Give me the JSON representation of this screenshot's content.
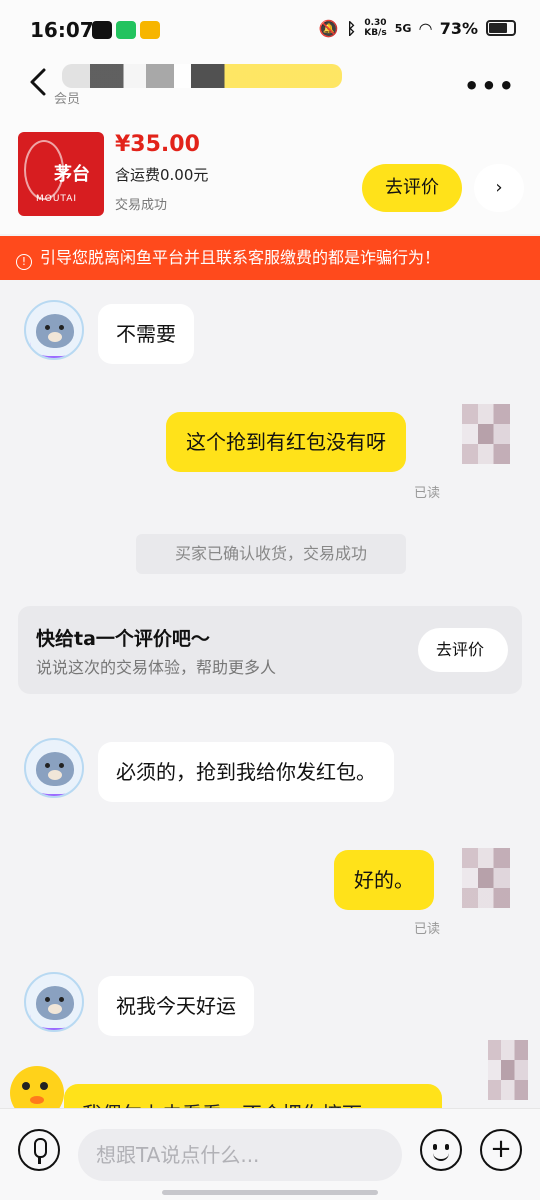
{
  "status_bar": {
    "time": "16:07",
    "net_speed": "0.30",
    "net_unit": "KB/s",
    "signal": "5G",
    "battery": "73%"
  },
  "header": {
    "subtitle": "会员",
    "more_label": "•••"
  },
  "product": {
    "brand_cn": "茅台",
    "brand_en": "MOUTAI",
    "price": "¥35.00",
    "shipping": "含运费0.00元",
    "status": "交易成功",
    "review_button": "去评价"
  },
  "warning": {
    "icon": "!",
    "text": "引导您脱离闲鱼平台并且联系客服缴费的都是诈骗行为！"
  },
  "messages": [
    {
      "side": "left",
      "text": "不需要"
    },
    {
      "side": "right",
      "text": "这个抢到有红包没有呀",
      "read": "已读"
    },
    {
      "side": "left",
      "text": "必须的，抢到我给你发红包。"
    },
    {
      "side": "right",
      "text": "好的。",
      "read": "已读"
    },
    {
      "side": "left",
      "text": "祝我今天好运"
    },
    {
      "side": "right",
      "text": "我偶尔上去看看，不会把你挤下"
    }
  ],
  "system_tip": "买家已确认收货，交易成功",
  "rate_card": {
    "title": "快给ta一个评价吧～",
    "subtitle": "说说这次的交易体验，帮助更多人",
    "button": "去评价"
  },
  "input_bar": {
    "placeholder": "想跟TA说点什么..."
  },
  "colors": {
    "accent_yellow": "#ffe21a",
    "warning_bg": "#ff4a1c",
    "price_red": "#e2231a"
  }
}
